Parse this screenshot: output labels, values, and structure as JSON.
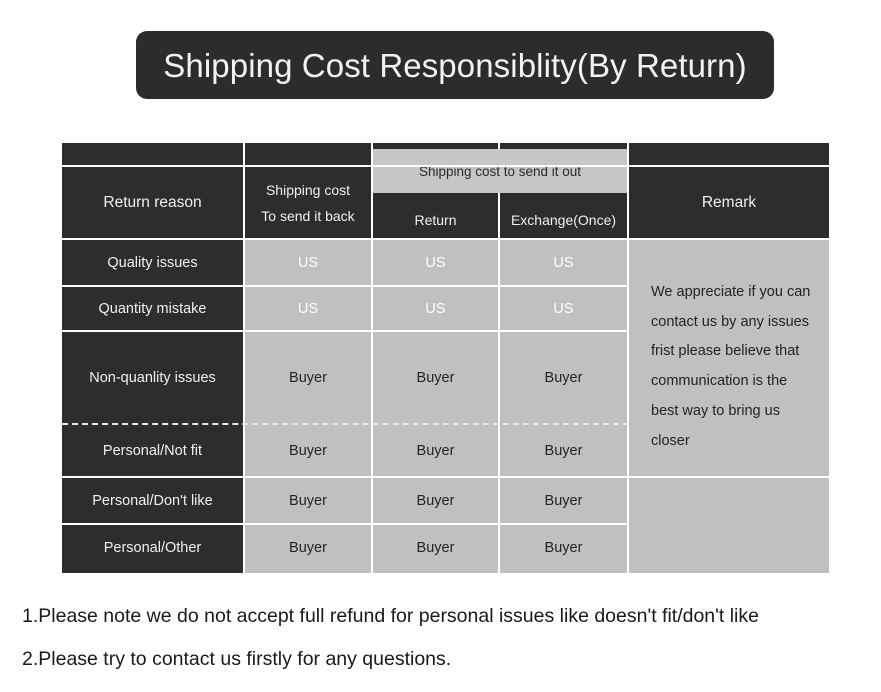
{
  "title": {
    "text": "Shipping Cost Responsiblity(By Return)",
    "background_color": "#2c2c2c",
    "text_color": "#f2f2f2"
  },
  "table": {
    "header": {
      "return_reason": "Return reason",
      "shipping_cost_line1": "Shipping cost",
      "shipping_cost_line2": "To send it back",
      "send_out_group": "Shipping cost to send it out",
      "sub_return": "Return",
      "sub_exchange": "Exchange(Once)",
      "remark": "Remark"
    },
    "rows": [
      {
        "reason": "Quality issues",
        "send_back": "US",
        "return": "US",
        "exchange": "US"
      },
      {
        "reason": "Quantity mistake",
        "send_back": "US",
        "return": "US",
        "exchange": "US"
      },
      {
        "reason": "Non-quanlity issues",
        "send_back": "Buyer",
        "return": "Buyer",
        "exchange": "Buyer"
      },
      {
        "reason": "Personal/Not fit",
        "send_back": "Buyer",
        "return": "Buyer",
        "exchange": "Buyer"
      },
      {
        "reason": "Personal/Don't like",
        "send_back": "Buyer",
        "return": "Buyer",
        "exchange": "Buyer"
      },
      {
        "reason": "Personal/Other",
        "send_back": "Buyer",
        "return": "Buyer",
        "exchange": "Buyer"
      }
    ],
    "remark_body": "We appreciate if you can contact us by any issues frist please believe that communication is the best way to bring us closer",
    "colors": {
      "dark_cell": "#2d2d2d",
      "light_cell": "#c0c0c0",
      "merged_band": "#c6c6c6",
      "divider": "#ffffff"
    }
  },
  "footer": {
    "notes": [
      "1.Please note we do not accept full refund for personal issues like doesn't fit/don't like",
      "2.Please try to contact us firstly for any questions."
    ]
  }
}
